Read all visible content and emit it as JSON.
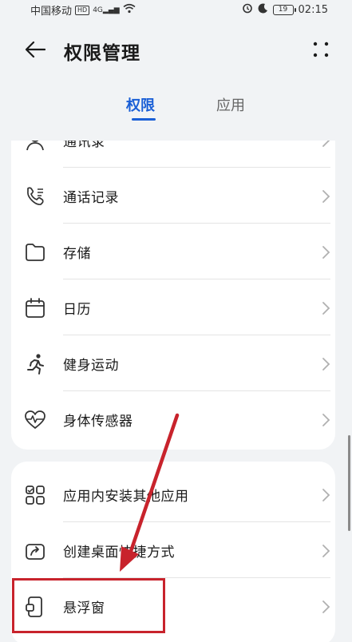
{
  "status_bar": {
    "carrier": "中国移动",
    "hd": "HD",
    "signal": "4G",
    "battery": "19",
    "time": "02:15"
  },
  "header": {
    "title": "权限管理"
  },
  "tabs": [
    {
      "label": "权限",
      "active": true
    },
    {
      "label": "应用",
      "active": false
    }
  ],
  "card1": {
    "items": [
      {
        "label": "通讯录",
        "icon": "contacts-icon"
      },
      {
        "label": "通话记录",
        "icon": "call-log-icon"
      },
      {
        "label": "存储",
        "icon": "folder-icon"
      },
      {
        "label": "日历",
        "icon": "calendar-icon"
      },
      {
        "label": "健身运动",
        "icon": "running-icon"
      },
      {
        "label": "身体传感器",
        "icon": "heart-rate-icon"
      }
    ]
  },
  "card2": {
    "items": [
      {
        "label": "应用内安装其他应用",
        "icon": "app-grid-icon"
      },
      {
        "label": "创建桌面快捷方式",
        "icon": "shortcut-icon"
      },
      {
        "label": "悬浮窗",
        "icon": "floating-window-icon"
      }
    ]
  },
  "colors": {
    "accent": "#1a5fd6",
    "annotation": "#c8232c"
  }
}
